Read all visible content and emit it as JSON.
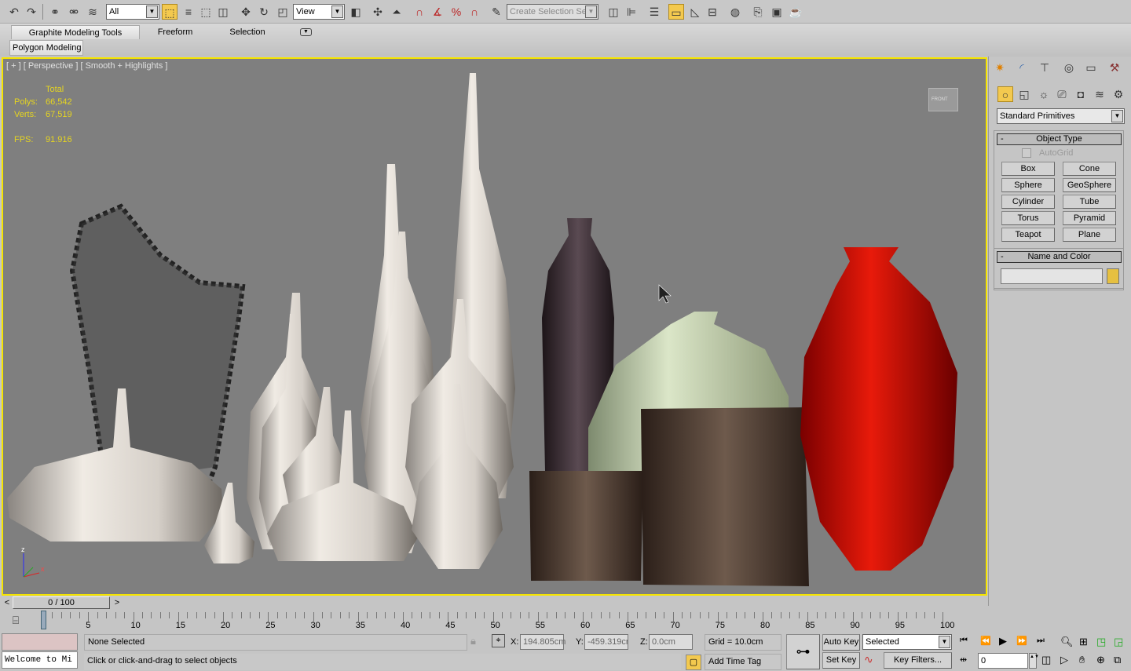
{
  "toolbar": {
    "selection_filter": "All",
    "reference_coord": "View",
    "named_selection_placeholder": "Create Selection Se",
    "icons": [
      "undo-icon",
      "redo-icon",
      "link-icon",
      "unlink-icon",
      "bind-space-warp-icon",
      "select-object-icon",
      "select-by-name-icon",
      "rect-selection-icon",
      "window-crossing-icon",
      "move-icon",
      "rotate-icon",
      "scale-icon",
      "pivot-icon",
      "manipulate-icon",
      "keyboard-shortcut-icon",
      "snap-3d-icon",
      "angle-snap-icon",
      "percent-snap-icon",
      "spinner-snap-icon",
      "edit-named-sets-icon",
      "mirror-icon",
      "align-icon",
      "layer-manager-icon",
      "graphite-toggle-icon",
      "curve-editor-icon",
      "schematic-view-icon",
      "material-editor-icon",
      "render-setup-icon",
      "rendered-frame-icon",
      "render-icon"
    ]
  },
  "ribbon": {
    "tabs": [
      "Graphite Modeling Tools",
      "Freeform",
      "Selection"
    ],
    "active_tab": 0,
    "panel": "Polygon Modeling"
  },
  "viewport": {
    "label": "[ + ] [ Perspective ] [ Smooth + Highlights ]",
    "stats": {
      "header": "Total",
      "polys_label": "Polys:",
      "polys": "66,542",
      "verts_label": "Verts:",
      "verts": "67,519",
      "fps_label": "FPS:",
      "fps": "91.916"
    },
    "viewcube": "FRONT",
    "axis": {
      "z": "z",
      "x": "x"
    },
    "border_color": "#f5e400"
  },
  "command_panel": {
    "tabs": [
      "create",
      "modify",
      "hierarchy",
      "motion",
      "display",
      "utilities"
    ],
    "category": "Standard Primitives",
    "object_type": {
      "title": "Object Type",
      "autogrid": "AutoGrid",
      "buttons": [
        "Box",
        "Cone",
        "Sphere",
        "GeoSphere",
        "Cylinder",
        "Tube",
        "Torus",
        "Pyramid",
        "Teapot",
        "Plane"
      ]
    },
    "name_color": {
      "title": "Name and Color",
      "name": "",
      "color": "#e6c040"
    }
  },
  "timeline": {
    "slider": "0 / 100",
    "prev": "<",
    "next": ">",
    "current": 0,
    "end": 100,
    "labels": [
      0,
      5,
      10,
      15,
      20,
      25,
      30,
      35,
      40,
      45,
      50,
      55,
      60,
      65,
      70,
      75,
      80,
      85,
      90,
      95,
      100
    ]
  },
  "status": {
    "listener": "Welcome to Mi",
    "selection": "None Selected",
    "prompt": "Click or click-and-drag to select objects",
    "x_label": "X:",
    "x": "194.805cm",
    "y_label": "Y:",
    "y": "-459.319cr",
    "z_label": "Z:",
    "z": "0.0cm",
    "grid": "Grid = 10.0cm",
    "add_time_tag": "Add Time Tag",
    "auto_key": "Auto Key",
    "set_key": "Set Key",
    "key_mode": "Selected",
    "key_filters": "Key Filters...",
    "frame": "0"
  }
}
